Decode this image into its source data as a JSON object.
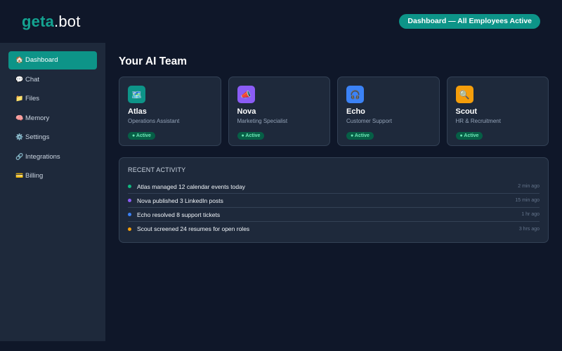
{
  "header": {
    "logo_brand": "geta",
    "logo_tld": ".bot",
    "status": "Dashboard — All Employees Active"
  },
  "sidebar": {
    "items": [
      {
        "icon": "🏠",
        "label": "Dashboard",
        "active": true
      },
      {
        "icon": "💬",
        "label": "Chat"
      },
      {
        "icon": "📁",
        "label": "Files"
      },
      {
        "icon": "🧠",
        "label": "Memory"
      },
      {
        "icon": "⚙️",
        "label": "Settings"
      },
      {
        "icon": "🔗",
        "label": "Integrations"
      },
      {
        "icon": "💳",
        "label": "Billing"
      }
    ]
  },
  "main": {
    "title": "Your AI Team",
    "employees": [
      {
        "icon": "🗺️",
        "color": "#0d9488",
        "name": "Atlas",
        "role": "Operations Assistant",
        "status": "● Active"
      },
      {
        "icon": "📣",
        "color": "#8b5cf6",
        "name": "Nova",
        "role": "Marketing Specialist",
        "status": "● Active"
      },
      {
        "icon": "🎧",
        "color": "#3b82f6",
        "name": "Echo",
        "role": "Customer Support",
        "status": "● Active"
      },
      {
        "icon": "🔍",
        "color": "#f59e0b",
        "name": "Scout",
        "role": "HR & Recruitment",
        "status": "● Active"
      }
    ],
    "activity": {
      "title": "Recent Activity",
      "rows": [
        {
          "color": "#10b981",
          "text": "Atlas managed 12 calendar events today",
          "time": "2 min ago"
        },
        {
          "color": "#8b5cf6",
          "text": "Nova published 3 LinkedIn posts",
          "time": "15 min ago"
        },
        {
          "color": "#3b82f6",
          "text": "Echo resolved 8 support tickets",
          "time": "1 hr ago"
        },
        {
          "color": "#f59e0b",
          "text": "Scout screened 24 resumes for open roles",
          "time": "3 hrs ago"
        }
      ]
    }
  }
}
